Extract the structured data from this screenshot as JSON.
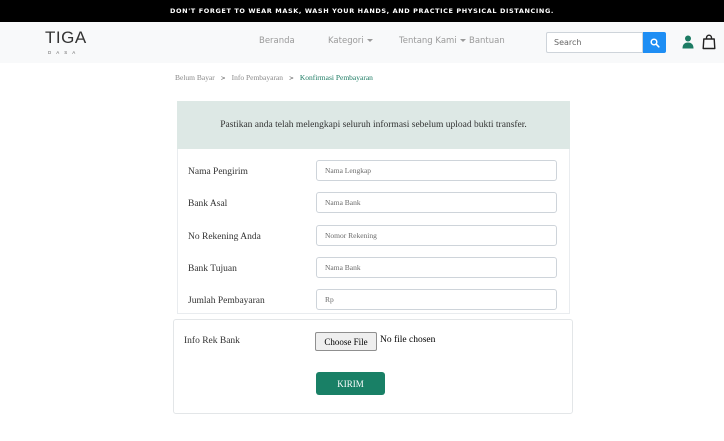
{
  "announcement": "DON'T FORGET TO WEAR MASK, WASH YOUR HANDS, AND PRACTICE PHYSICAL DISTANCING.",
  "brand": {
    "name": "TIGA",
    "tagline": "DASA"
  },
  "nav": {
    "home": "Beranda",
    "category": "Kategori",
    "about": "Tentang Kami",
    "help": "Bantuan"
  },
  "search": {
    "placeholder": "Search"
  },
  "icons": {
    "search": "search-icon",
    "user": "user-icon",
    "cart": "shopping-bag-icon"
  },
  "colors": {
    "accent": "#198066",
    "search_button": "#1e8ef4",
    "notice_bg": "#dde8e5"
  },
  "breadcrumb": {
    "step1": "Belum Bayar",
    "step2": "Info Pembayaran",
    "step3": "Konfirmasi Pembayaran",
    "separator": ">"
  },
  "notice": "Pastikan anda telah melengkapi seluruh informasi sebelum upload bukti transfer.",
  "form": {
    "fields": [
      {
        "label": "Nama Pengirim",
        "placeholder": "Nama Lengkap",
        "value": ""
      },
      {
        "label": "Bank Asal",
        "placeholder": "Nama Bank",
        "value": ""
      },
      {
        "label": "No Rekening Anda",
        "placeholder": "Nomor Rekening",
        "value": ""
      },
      {
        "label": "Bank Tujuan",
        "placeholder": "Nama Bank",
        "value": ""
      },
      {
        "label": "Jumlah Pembayaran",
        "placeholder": "Rp",
        "value": ""
      }
    ],
    "upload": {
      "label": "Info Rek Bank",
      "button": "Choose File",
      "status": "No file chosen"
    },
    "submit": "KIRIM"
  }
}
